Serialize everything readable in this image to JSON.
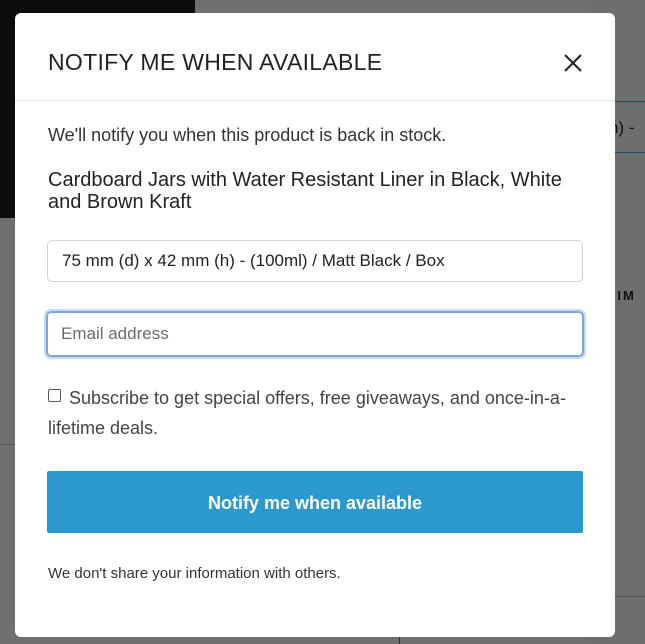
{
  "background": {
    "variant_fragment": "h) -",
    "dim_fragment": "DIM"
  },
  "modal": {
    "title": "NOTIFY ME WHEN AVAILABLE",
    "close_icon": "close-icon",
    "intro": "We'll notify you when this product is back in stock.",
    "product_name": "Cardboard Jars with Water Resistant Liner in Black, White and Brown Kraft",
    "variant_value": "75 mm (d) x 42 mm (h) - (100ml) / Matt Black / Box",
    "email_placeholder": "Email address",
    "email_value": "",
    "subscribe_label": "Subscribe to get special offers, free giveaways, and once-in-a-lifetime deals.",
    "subscribe_checked": false,
    "notify_button": "Notify me when available",
    "disclaimer": "We don't share your information with others."
  },
  "colors": {
    "accent": "#2b99ce",
    "overlay": "#6f6f6f",
    "focus_ring": "#7fa6d9"
  }
}
